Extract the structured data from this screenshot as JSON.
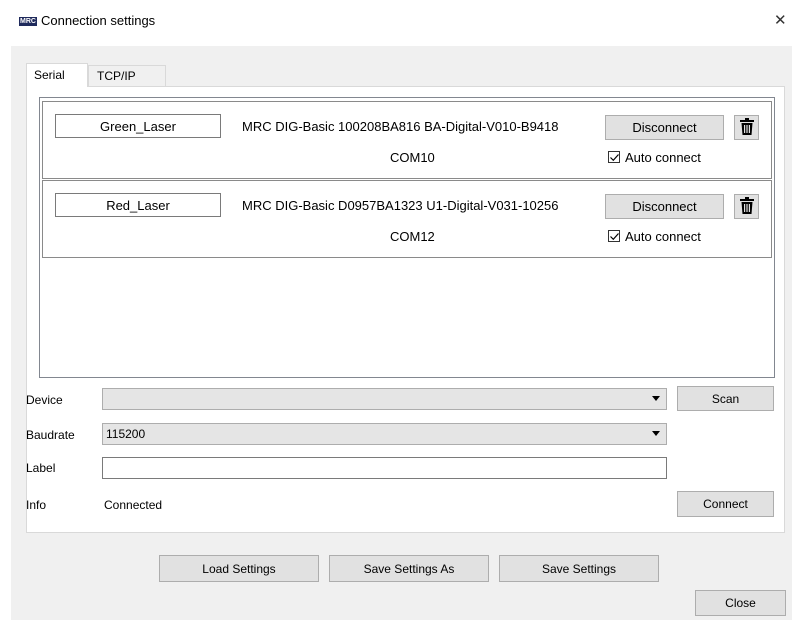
{
  "window": {
    "logo_text": "MRC",
    "title": "Connection settings",
    "close_glyph": "✕"
  },
  "tabs": [
    {
      "label": "Serial",
      "active": true
    },
    {
      "label": "TCP/IP",
      "active": false
    }
  ],
  "devices": [
    {
      "label": "Green_Laser",
      "name": "MRC DIG-Basic 100208BA816 BA-Digital-V010-B9418",
      "port": "COM10",
      "button": "Disconnect",
      "auto_connect_label": "Auto connect",
      "auto_connect": true,
      "delete_icon": "trash-icon"
    },
    {
      "label": "Red_Laser",
      "name": "MRC DIG-Basic D0957BA1323 U1-Digital-V031-10256",
      "port": "COM12",
      "button": "Disconnect",
      "auto_connect_label": "Auto connect",
      "auto_connect": true,
      "delete_icon": "trash-icon"
    }
  ],
  "form": {
    "device_label": "Device",
    "device_value": "",
    "scan_button": "Scan",
    "baudrate_label": "Baudrate",
    "baudrate_value": "115200",
    "label_label": "Label",
    "label_value": "",
    "info_label": "Info",
    "info_value": "Connected",
    "connect_button": "Connect"
  },
  "footer": {
    "load_settings": "Load Settings",
    "save_settings_as": "Save Settings As",
    "save_settings": "Save Settings",
    "close": "Close"
  },
  "colors": {
    "window_bg": "#f0f0f0",
    "button_bg": "#e1e1e1",
    "border": "#adadad"
  }
}
